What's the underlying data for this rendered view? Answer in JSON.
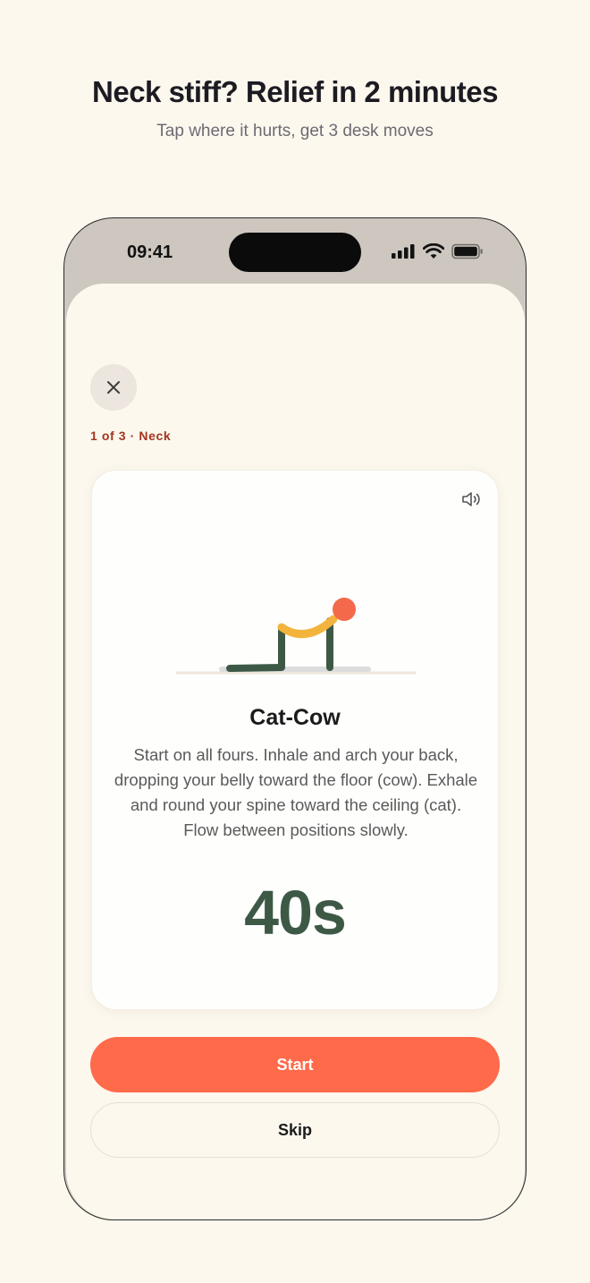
{
  "header": {
    "title": "Neck stiff? Relief in 2 minutes",
    "subtitle": "Tap where it hurts, get 3 desk moves"
  },
  "status_bar": {
    "time": "09:41",
    "icons": [
      "cellular-signal-icon",
      "wifi-icon",
      "battery-icon"
    ]
  },
  "session": {
    "close_icon": "close-icon",
    "progress": "1 of 3 · Neck"
  },
  "exercise": {
    "sound_icon": "speaker-icon",
    "illustration": "cat-cow-pose-illustration",
    "title": "Cat-Cow",
    "description": "Start on all fours. Inhale and arch your back, dropping your belly toward the floor (cow). Exhale and round your spine toward the ceiling (cat). Flow between positions slowly.",
    "timer": "40s"
  },
  "actions": {
    "start_label": "Start",
    "skip_label": "Skip"
  },
  "colors": {
    "background": "#fcf8ee",
    "accent": "#ff6a4a",
    "progress_text": "#a3341f",
    "timer_green": "#3d5946",
    "figure_green": "#3d5946",
    "spine_yellow": "#f2b43c",
    "head_orange": "#f4694a"
  }
}
